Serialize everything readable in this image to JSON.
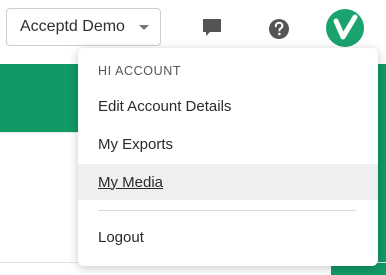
{
  "header": {
    "account_selector_label": "Acceptd Demo",
    "icons": {
      "chat": "chat-bubble-icon",
      "help": "help-circle-icon",
      "avatar": "acceptd-logo-icon"
    }
  },
  "account_menu": {
    "header": "HI ACCOUNT",
    "items": [
      {
        "label": "Edit Account Details"
      },
      {
        "label": "My Exports"
      },
      {
        "label": "My Media",
        "state": "hovered"
      }
    ],
    "logout_label": "Logout"
  },
  "colors": {
    "brand_green": "#119a66",
    "icon_gray": "#555555"
  }
}
